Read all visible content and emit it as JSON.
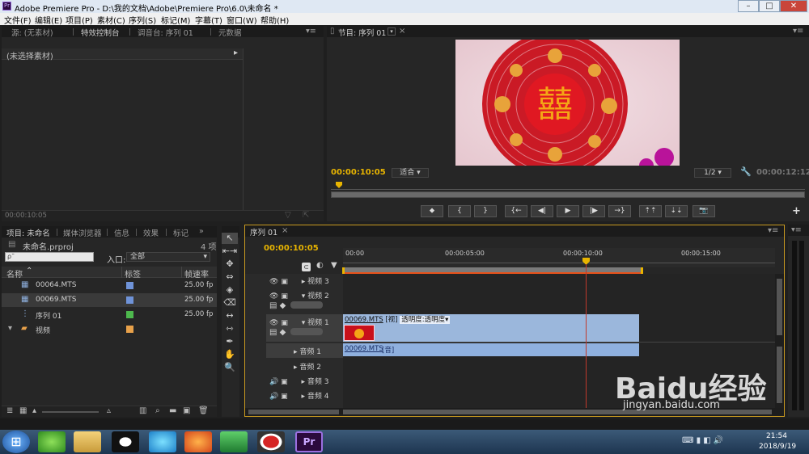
{
  "window": {
    "app_icon": "Pr",
    "title": "Adobe Premiere Pro - D:\\我的文档\\Adobe\\Premiere Pro\\6.0\\未命名 *",
    "min": "–",
    "max": "□",
    "close": "✕"
  },
  "menu": [
    "文件(F)",
    "编辑(E)",
    "项目(P)",
    "素材(C)",
    "序列(S)",
    "标记(M)",
    "字幕(T)",
    "窗口(W)",
    "帮助(H)"
  ],
  "source_panel": {
    "tabs": [
      "源: (无素材)",
      "特效控制台",
      "调音台: 序列 01",
      "元数据"
    ],
    "clip_label": "(未选择素材)",
    "timecode": "00:00:10:05"
  },
  "program_monitor": {
    "tab": "节目: 序列 01",
    "timecode_current": "00:00:10:05",
    "fit_label": "适合",
    "resolution": "1/2",
    "timecode_total": "00:00:12:12",
    "preview": {
      "main_char": "囍",
      "mini_char": "囍"
    },
    "transport": [
      "⬥",
      "{",
      "}",
      "{←",
      "◀|",
      "▶",
      "|▶",
      "→}",
      "⇡⇡",
      "⇣⇣",
      "📷"
    ],
    "add": "+"
  },
  "project_panel": {
    "tabs": [
      "项目: 未命名",
      "媒体浏览器",
      "信息",
      "效果",
      "标记"
    ],
    "project_file": "未命名.prproj",
    "item_count": "4 项",
    "search_placeholder": "ρ˜",
    "in_label": "入口:",
    "in_value": "全部",
    "columns": [
      "名称",
      "标签",
      "帧速率"
    ],
    "items": [
      {
        "name": "00064.MTS",
        "label_color": "#6f93d8",
        "rate": "25.00 fp",
        "type": "clip"
      },
      {
        "name": "00069.MTS",
        "label_color": "#6f93d8",
        "rate": "25.00 fp",
        "type": "clip"
      },
      {
        "name": "序列 01",
        "label_color": "#4db84d",
        "rate": "25.00 fp",
        "type": "sequence"
      },
      {
        "name": "视频",
        "label_color": "#e8a14a",
        "rate": "",
        "type": "bin"
      }
    ]
  },
  "timeline": {
    "tab": "序列 01",
    "timecode": "00:00:10:05",
    "ruler": [
      "00:00",
      "00:00:05:00",
      "00:00:10:00",
      "00:00:15:00"
    ],
    "video_tracks": [
      "视频 3",
      "视频 2",
      "视频 1"
    ],
    "audio_tracks": [
      "音频 1",
      "音频 2",
      "音频 3",
      "音频 4"
    ],
    "video_clip": {
      "name": "00069.MTS",
      "tag": "[视]",
      "effect": "透明度:透明度"
    },
    "audio_clip": {
      "name": "00069.MTS",
      "tag": "[音]"
    }
  },
  "tools": [
    "↖",
    "⇤⇥",
    "✥",
    "⇔",
    "◈",
    "⌫",
    "↔",
    "⇿",
    "✒",
    "✋",
    "🔍"
  ],
  "taskbar": {
    "time": "21:54",
    "date": "2018/9/19",
    "start": "⊞"
  },
  "watermark": {
    "brand": "Baidu经验",
    "url": "jingyan.baidu.com"
  },
  "colors": {
    "accent": "#e8b400",
    "playhead": "#c0392b",
    "clip": "#9bb7dc"
  }
}
